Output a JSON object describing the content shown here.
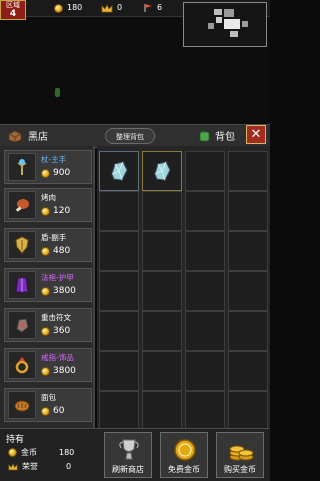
{
  "hud": {
    "region_label": "区域",
    "region_number": "4",
    "gold": "180",
    "crowns": "0",
    "flag": "6"
  },
  "tabs": {
    "shop": "黑店",
    "sort": "整理背包",
    "bag": "背包",
    "close": "✕"
  },
  "shop_items": [
    {
      "name": "杖-主手",
      "price": "900",
      "name_color": "#6fb5ff"
    },
    {
      "name": "烤肉",
      "price": "120",
      "name_color": "#ffffff"
    },
    {
      "name": "盾-副手",
      "price": "480",
      "name_color": "#ffffff"
    },
    {
      "name": "法袍-护甲",
      "price": "3800",
      "name_color": "#d36bff"
    },
    {
      "name": "重击符文",
      "price": "360",
      "name_color": "#ffffff"
    },
    {
      "name": "戒指-饰品",
      "price": "3800",
      "name_color": "#d36bff"
    },
    {
      "name": "面包",
      "price": "60",
      "name_color": "#ffffff"
    }
  ],
  "holdings": {
    "title": "持有",
    "gold_label": "金币",
    "gold_value": "180",
    "honor_label": "荣誉",
    "honor_value": "0"
  },
  "buttons": {
    "refresh": "刷新商店",
    "free_gold": "免费金币",
    "buy_gold": "购买金币"
  },
  "colors": {
    "region_bg": "#8e1f16",
    "close_bg": "#a32c1e",
    "gold": "#e0a816",
    "epic": "#d36bff",
    "rare": "#6fb5ff"
  }
}
